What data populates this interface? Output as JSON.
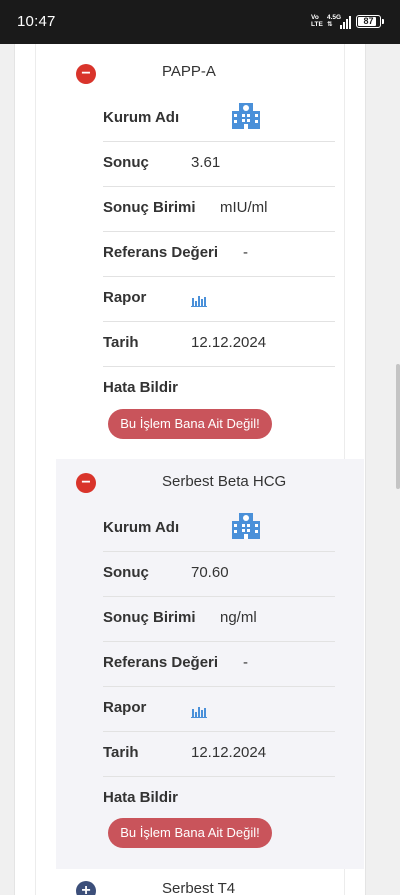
{
  "status_bar": {
    "time": "10:47",
    "network_top": "Vo",
    "network_bottom": "LTE",
    "speed_top": "4.5G",
    "speed_bottom": "⇅",
    "battery": "87"
  },
  "sections": [
    {
      "title": "PAPP-A",
      "expanded": true,
      "rows": {
        "kurum_label": "Kurum Adı",
        "sonuc_label": "Sonuç",
        "sonuc_value": "3.61",
        "birim_label": "Sonuç Birimi",
        "birim_value": "mIU/ml",
        "referans_label": "Referans Değeri",
        "referans_value": "-",
        "rapor_label": "Rapor",
        "tarih_label": "Tarih",
        "tarih_value": "12.12.2024",
        "hata_label": "Hata Bildir"
      },
      "error_button": "Bu İşlem Bana Ait Değil!"
    },
    {
      "title": "Serbest Beta HCG",
      "expanded": true,
      "rows": {
        "kurum_label": "Kurum Adı",
        "sonuc_label": "Sonuç",
        "sonuc_value": "70.60",
        "birim_label": "Sonuç Birimi",
        "birim_value": "ng/ml",
        "referans_label": "Referans Değeri",
        "referans_value": "-",
        "rapor_label": "Rapor",
        "tarih_label": "Tarih",
        "tarih_value": "12.12.2024",
        "hata_label": "Hata Bildir"
      },
      "error_button": "Bu İşlem Bana Ait Değil!"
    },
    {
      "title": "Serbest T4",
      "expanded": false
    }
  ],
  "icons": {
    "toggle_collapse": "minus-icon",
    "toggle_expand": "plus-icon",
    "institution": "hospital-icon",
    "report": "bar-chart-icon"
  },
  "colors": {
    "collapse_toggle": "#d9342b",
    "expand_toggle": "#3c4f7a",
    "error_button": "#c9545b",
    "icon_blue": "#4a90d9"
  },
  "glyphs": {
    "minus": "−",
    "plus": "+"
  }
}
